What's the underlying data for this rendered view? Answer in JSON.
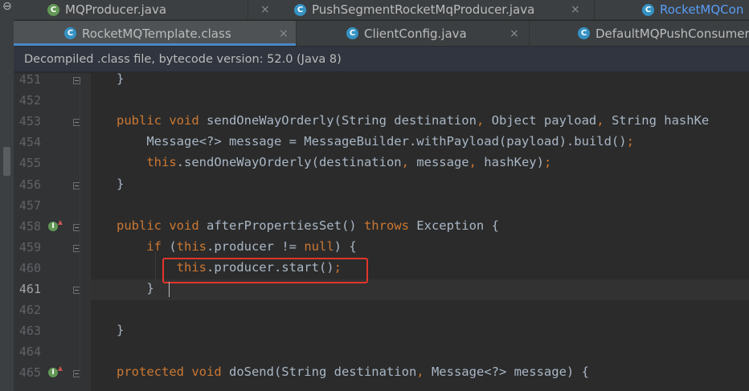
{
  "tabs_row1": [
    {
      "label": "MQProducer.java",
      "icon": "java-class-icon",
      "icon_char": "C",
      "active": false
    },
    {
      "label": "PushSegmentRocketMqProducer.java",
      "icon": "java-class-icon",
      "icon_char": "C",
      "active": false
    },
    {
      "label": "RocketMQCon",
      "icon": "java-class-icon",
      "icon_char": "C",
      "active": false
    }
  ],
  "tabs_row2": [
    {
      "label": "RocketMQTemplate.class",
      "icon": "java-class-icon",
      "icon_char": "C",
      "active": true
    },
    {
      "label": "ClientConfig.java",
      "icon": "java-class-icon",
      "icon_char": "C",
      "active": false
    },
    {
      "label": "DefaultMQPushConsumer",
      "icon": "java-class-icon",
      "icon_char": "C",
      "active": false
    }
  ],
  "close_glyph": "×",
  "left_toolbar_glyph": "⊖",
  "info_bar": {
    "text": "Decompiled .class file, bytecode version: 52.0 (Java 8)"
  },
  "editor": {
    "current_line": "461",
    "line_numbers": [
      "451",
      "452",
      "453",
      "454",
      "455",
      "456",
      "457",
      "458",
      "459",
      "460",
      "461",
      "462",
      "463",
      "464",
      "465"
    ],
    "lines": [
      {
        "segments": [
          {
            "t": "}",
            "c": "plain"
          }
        ]
      },
      {
        "segments": []
      },
      {
        "segments": [
          {
            "t": "public void ",
            "c": "kw"
          },
          {
            "t": "sendOneWayOrderly(String destination",
            "c": "plain"
          },
          {
            "t": ", ",
            "c": "kw"
          },
          {
            "t": "Object payload",
            "c": "plain"
          },
          {
            "t": ", ",
            "c": "kw"
          },
          {
            "t": "String hashKe",
            "c": "plain"
          }
        ]
      },
      {
        "segments": [
          {
            "t": "    Message<?> message = MessageBuilder.withPayload(payload).build()",
            "c": "plain"
          },
          {
            "t": ";",
            "c": "kw"
          }
        ]
      },
      {
        "segments": [
          {
            "t": "    ",
            "c": "plain"
          },
          {
            "t": "this",
            "c": "kw"
          },
          {
            "t": ".sendOneWayOrderly(destination",
            "c": "plain"
          },
          {
            "t": ", ",
            "c": "kw"
          },
          {
            "t": "message",
            "c": "plain"
          },
          {
            "t": ", ",
            "c": "kw"
          },
          {
            "t": "hashKey)",
            "c": "plain"
          },
          {
            "t": ";",
            "c": "kw"
          }
        ]
      },
      {
        "segments": [
          {
            "t": "}",
            "c": "plain"
          }
        ]
      },
      {
        "segments": []
      },
      {
        "segments": [
          {
            "t": "public void ",
            "c": "kw"
          },
          {
            "t": "afterPropertiesSet() ",
            "c": "plain"
          },
          {
            "t": "throws ",
            "c": "kw"
          },
          {
            "t": "Exception {",
            "c": "plain"
          }
        ]
      },
      {
        "segments": [
          {
            "t": "    ",
            "c": "plain"
          },
          {
            "t": "if ",
            "c": "kw"
          },
          {
            "t": "(",
            "c": "plain"
          },
          {
            "t": "this",
            "c": "kw"
          },
          {
            "t": ".producer != ",
            "c": "plain"
          },
          {
            "t": "null",
            "c": "kw"
          },
          {
            "t": ") {",
            "c": "plain"
          }
        ]
      },
      {
        "segments": [
          {
            "t": "        ",
            "c": "plain"
          },
          {
            "t": "this",
            "c": "kw"
          },
          {
            "t": ".producer.start()",
            "c": "plain"
          },
          {
            "t": ";",
            "c": "kw"
          }
        ]
      },
      {
        "segments": [
          {
            "t": "    }",
            "c": "plain"
          }
        ]
      },
      {
        "segments": []
      },
      {
        "segments": [
          {
            "t": "}",
            "c": "plain"
          }
        ]
      },
      {
        "segments": []
      },
      {
        "segments": [
          {
            "t": "protected void ",
            "c": "kw"
          },
          {
            "t": "doSend(String destination",
            "c": "plain"
          },
          {
            "t": ", ",
            "c": "kw"
          },
          {
            "t": "Message<?> message) {",
            "c": "plain"
          }
        ]
      }
    ]
  },
  "colors": {
    "keyword": "#cc7832",
    "plain": "#a9b7c6",
    "highlight_box": "#e2342c",
    "active_tab_underline": "#4a88c7"
  }
}
